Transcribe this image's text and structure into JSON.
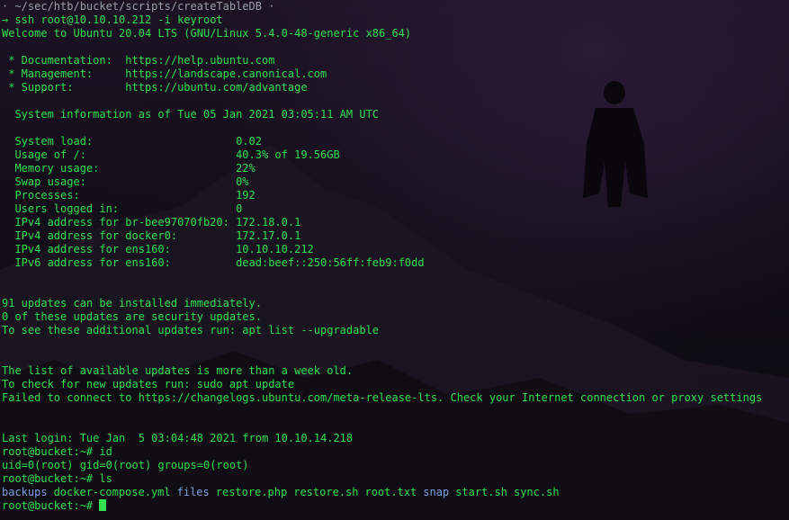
{
  "terminal": {
    "title_line": "· ~/sec/htb/bucket/scripts/createTableDB ·",
    "lines": [
      "→ ssh root@10.10.10.212 -i keyroot",
      "Welcome to Ubuntu 20.04 LTS (GNU/Linux 5.4.0-48-generic x86_64)",
      "",
      " * Documentation:  https://help.ubuntu.com",
      " * Management:     https://landscape.canonical.com",
      " * Support:        https://ubuntu.com/advantage",
      "",
      "  System information as of Tue 05 Jan 2021 03:05:11 AM UTC",
      "",
      "  System load:                      0.02",
      "  Usage of /:                       40.3% of 19.56GB",
      "  Memory usage:                     22%",
      "  Swap usage:                       0%",
      "  Processes:                        192",
      "  Users logged in:                  0",
      "  IPv4 address for br-bee97070fb20: 172.18.0.1",
      "  IPv4 address for docker0:         172.17.0.1",
      "  IPv4 address for ens160:          10.10.10.212",
      "  IPv6 address for ens160:          dead:beef::250:56ff:feb9:f0dd",
      "",
      "",
      "91 updates can be installed immediately.",
      "0 of these updates are security updates.",
      "To see these additional updates run: apt list --upgradable",
      "",
      "",
      "The list of available updates is more than a week old.",
      "To check for new updates run: sudo apt update",
      "Failed to connect to https://changelogs.ubuntu.com/meta-release-lts. Check your Internet connection or proxy settings",
      "",
      "",
      "Last login: Tue Jan  5 03:04:48 2021 from 10.10.14.218",
      "root@bucket:~# id",
      "uid=0(root) gid=0(root) groups=0(root)",
      "root@bucket:~# ls"
    ],
    "ls_output": [
      {
        "name": "backups",
        "kind": "dir"
      },
      {
        "name": "docker-compose.yml",
        "kind": "file"
      },
      {
        "name": "files",
        "kind": "dir"
      },
      {
        "name": "restore.php",
        "kind": "file"
      },
      {
        "name": "restore.sh",
        "kind": "file"
      },
      {
        "name": "root.txt",
        "kind": "file"
      },
      {
        "name": "snap",
        "kind": "dir"
      },
      {
        "name": "start.sh",
        "kind": "file"
      },
      {
        "name": "sync.sh",
        "kind": "file"
      }
    ],
    "prompt": "root@bucket:~#",
    "colors": {
      "text": "#2fe050",
      "directory": "#7d9fe2",
      "title": "#9aa0a8",
      "background": "#120e19"
    }
  }
}
